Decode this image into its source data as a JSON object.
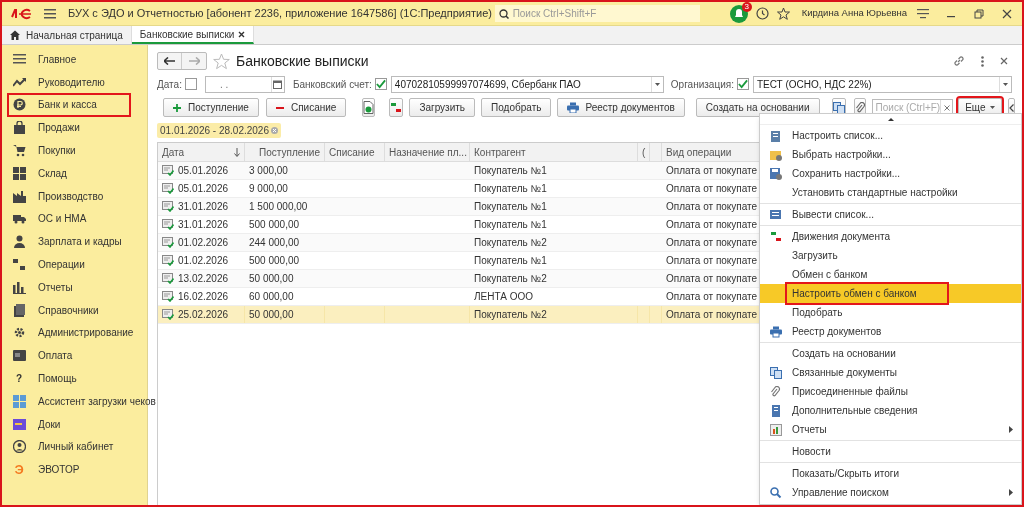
{
  "app": {
    "title": "БУХ с ЭДО и Отчетностью [абонент 2236, приложение 1647586]  (1С:Предприятие)",
    "search_placeholder": "Поиск Ctrl+Shift+F",
    "notification_count": "3",
    "user": "Кирдина Анна Юрьевна"
  },
  "open_tabs": [
    {
      "label": "Начальная страница",
      "selected": false
    },
    {
      "label": "Банковские выписки",
      "selected": true
    }
  ],
  "sidebar": {
    "items": [
      {
        "label": "Главное",
        "highlighted": false
      },
      {
        "label": "Руководителю",
        "highlighted": false
      },
      {
        "label": "Банк и касса",
        "highlighted": true
      },
      {
        "label": "Продажи",
        "highlighted": false
      },
      {
        "label": "Покупки",
        "highlighted": false
      },
      {
        "label": "Склад",
        "highlighted": false
      },
      {
        "label": "Производство",
        "highlighted": false
      },
      {
        "label": "ОС и НМА",
        "highlighted": false
      },
      {
        "label": "Зарплата и кадры",
        "highlighted": false
      },
      {
        "label": "Операции",
        "highlighted": false
      },
      {
        "label": "Отчеты",
        "highlighted": false
      },
      {
        "label": "Справочники",
        "highlighted": false
      },
      {
        "label": "Администрирование",
        "highlighted": false
      },
      {
        "label": "Оплата",
        "highlighted": false
      },
      {
        "label": "Помощь",
        "highlighted": false,
        "glyph": "?"
      },
      {
        "label": "Ассистент загрузки чеков",
        "highlighted": false
      },
      {
        "label": "Доки",
        "highlighted": false
      },
      {
        "label": "Личный кабинет",
        "highlighted": false
      },
      {
        "label": "ЭВОТОР",
        "highlighted": false,
        "glyph": "Э"
      }
    ]
  },
  "form": {
    "title": "Банковские выписки",
    "filters": {
      "date_label": "Дата:",
      "date_checked": false,
      "date_value": ". .",
      "account_label": "Банковский счет:",
      "account_checked": true,
      "account_value": "40702810599997074699, Сбербанк ПАО",
      "org_label": "Организация:",
      "org_checked": true,
      "org_value": "ТЕСТ (ОСНО, НДС 22%)"
    },
    "toolbar": [
      {
        "kind": "plus",
        "label": "Поступление"
      },
      {
        "kind": "minus",
        "label": "Списание"
      },
      {
        "kind": "icon"
      },
      {
        "kind": "icon"
      },
      {
        "kind": "text",
        "label": "Загрузить"
      },
      {
        "kind": "text",
        "label": "Подобрать"
      },
      {
        "kind": "printer",
        "label": "Реестр документов"
      },
      {
        "kind": "text",
        "label": "Создать на основании"
      },
      {
        "kind": "icon"
      },
      {
        "kind": "icon"
      },
      {
        "kind": "search",
        "placeholder": "Поиск (Ctrl+F)"
      },
      {
        "kind": "more",
        "label": "Еще",
        "highlighted": true
      },
      {
        "kind": "icon"
      }
    ],
    "period": "01.01.2026 - 28.02.2026",
    "table": {
      "columns": [
        {
          "label": "Дата",
          "sorted": true
        },
        {
          "label": "Поступление"
        },
        {
          "label": "Списание"
        },
        {
          "label": "Назначение пл..."
        },
        {
          "label": "Контрагент"
        },
        {
          "label": "("
        },
        {},
        {
          "label": "Вид операции"
        }
      ],
      "rows": [
        {
          "selected": false,
          "cells": [
            "05.01.2026",
            "3 000,00",
            "",
            "",
            "Покупатель №1",
            "",
            "",
            "Оплата от покупате"
          ]
        },
        {
          "selected": false,
          "cells": [
            "05.01.2026",
            "9 000,00",
            "",
            "",
            "Покупатель №1",
            "",
            "",
            "Оплата от покупате"
          ]
        },
        {
          "selected": false,
          "cells": [
            "31.01.2026",
            "1 500 000,00",
            "",
            "",
            "Покупатель №1",
            "",
            "",
            "Оплата от покупате"
          ]
        },
        {
          "selected": false,
          "cells": [
            "31.01.2026",
            "500 000,00",
            "",
            "",
            "Покупатель №1",
            "",
            "",
            "Оплата от покупате"
          ]
        },
        {
          "selected": false,
          "cells": [
            "01.02.2026",
            "244 000,00",
            "",
            "",
            "Покупатель №2",
            "",
            "",
            "Оплата от покупате"
          ]
        },
        {
          "selected": false,
          "cells": [
            "01.02.2026",
            "500 000,00",
            "",
            "",
            "Покупатель №1",
            "",
            "",
            "Оплата от покупате"
          ]
        },
        {
          "selected": false,
          "cells": [
            "13.02.2026",
            "50 000,00",
            "",
            "",
            "Покупатель №2",
            "",
            "",
            "Оплата от покупате"
          ]
        },
        {
          "selected": false,
          "cells": [
            "16.02.2026",
            "60 000,00",
            "",
            "",
            "ЛЕНТА ООО",
            "",
            "",
            "Оплата от покупате"
          ]
        },
        {
          "selected": true,
          "cells": [
            "25.02.2026",
            "50 000,00",
            "",
            "",
            "Покупатель №2",
            "",
            "",
            "Оплата от покупате"
          ]
        }
      ]
    }
  },
  "more_menu": {
    "groups": [
      {
        "items": [
          {
            "label": "Настроить список...",
            "selected": false,
            "highlighted": false,
            "submenu": false
          },
          {
            "label": "Выбрать настройки...",
            "selected": false,
            "highlighted": false,
            "submenu": false
          },
          {
            "label": "Сохранить настройки...",
            "selected": false,
            "highlighted": false,
            "submenu": false
          },
          {
            "label": "Установить стандартные настройки",
            "selected": false,
            "highlighted": false,
            "submenu": false
          }
        ]
      },
      {
        "items": [
          {
            "label": "Вывести список...",
            "selected": false,
            "highlighted": false,
            "submenu": false
          }
        ]
      },
      {
        "items": [
          {
            "label": "Движения документа",
            "selected": false,
            "highlighted": false,
            "submenu": false
          },
          {
            "label": "Загрузить",
            "selected": false,
            "highlighted": false,
            "submenu": false
          },
          {
            "label": "Обмен с банком",
            "selected": false,
            "highlighted": false,
            "submenu": false
          },
          {
            "label": "Настроить обмен с банком",
            "selected": true,
            "highlighted": true,
            "submenu": false
          },
          {
            "label": "Подобрать",
            "selected": false,
            "highlighted": false,
            "submenu": false
          },
          {
            "label": "Реестр документов",
            "selected": false,
            "highlighted": false,
            "submenu": false
          }
        ]
      },
      {
        "items": [
          {
            "label": "Создать на основании",
            "selected": false,
            "highlighted": false,
            "submenu": false
          },
          {
            "label": "Связанные документы",
            "selected": false,
            "highlighted": false,
            "submenu": false
          },
          {
            "label": "Присоединенные файлы",
            "selected": false,
            "highlighted": false,
            "submenu": false
          },
          {
            "label": "Дополнительные сведения",
            "selected": false,
            "highlighted": false,
            "submenu": false
          },
          {
            "label": "Отчеты",
            "selected": false,
            "highlighted": false,
            "submenu": true
          }
        ]
      },
      {
        "items": [
          {
            "label": "Новости",
            "selected": false,
            "highlighted": false,
            "submenu": false
          }
        ]
      },
      {
        "items": [
          {
            "label": "Показать/Скрыть итоги",
            "selected": false,
            "highlighted": false,
            "submenu": false
          },
          {
            "label": "Управление поиском",
            "selected": false,
            "highlighted": false,
            "submenu": true
          }
        ]
      }
    ]
  }
}
